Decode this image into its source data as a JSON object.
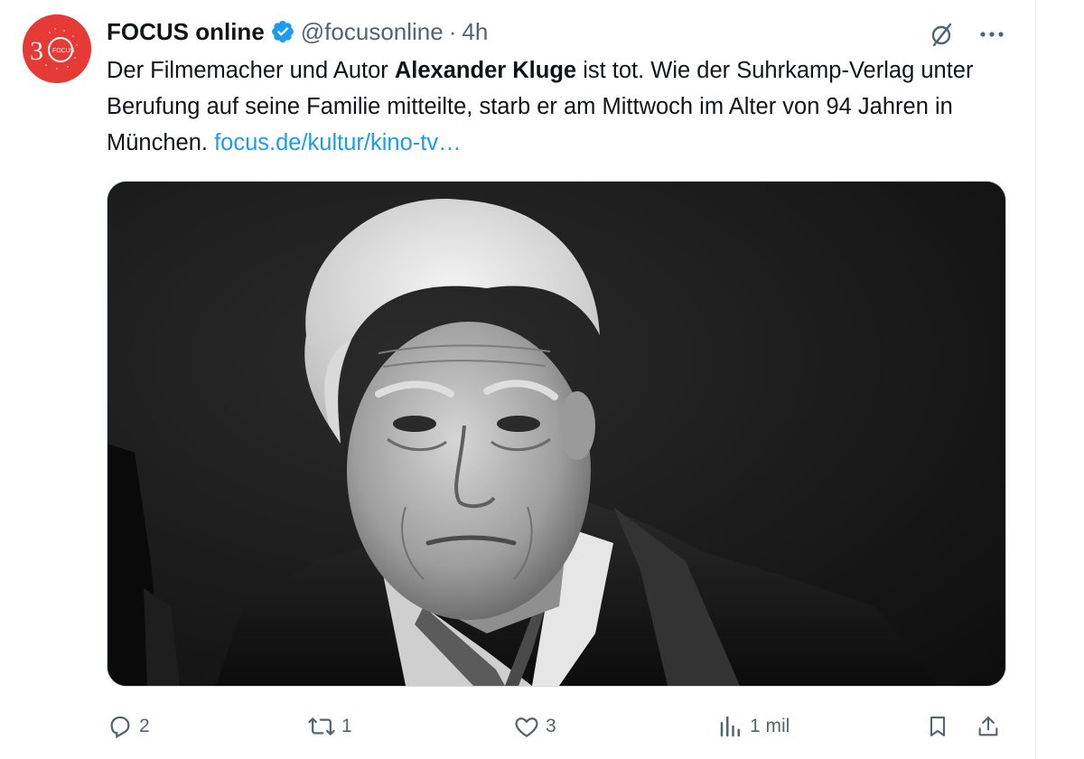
{
  "account": {
    "display_name": "FOCUS online",
    "handle": "@focusonline",
    "separator": "·",
    "time": "4h",
    "verified": true,
    "avatar_text": "30 FOCUS",
    "brand_color": "#e53a36"
  },
  "tweet": {
    "text_part1": "Der Filmemacher und Autor ",
    "text_bold": "Alexander Kluge",
    "text_part2": " ist tot. Wie der Suhrkamp-Verlag unter Berufung auf seine Familie mitteilte, starb er am Mittwoch im Alter von 94 Jahren in München. ",
    "link_text": "focus.de/kultur/kino-tv…",
    "link_color": "#1d9bf0"
  },
  "media": {
    "type": "black-and-white portrait photo"
  },
  "actions": {
    "reply_count": "2",
    "retweet_count": "1",
    "like_count": "3",
    "views_count": "1 mil"
  },
  "icons": [
    "verified-badge-icon",
    "grok-icon",
    "more-icon",
    "reply-icon",
    "retweet-icon",
    "like-icon",
    "views-icon",
    "bookmark-icon",
    "share-icon"
  ],
  "colors": {
    "text": "#0f1419",
    "secondary": "#536471",
    "verified": "#1d9bf0"
  }
}
